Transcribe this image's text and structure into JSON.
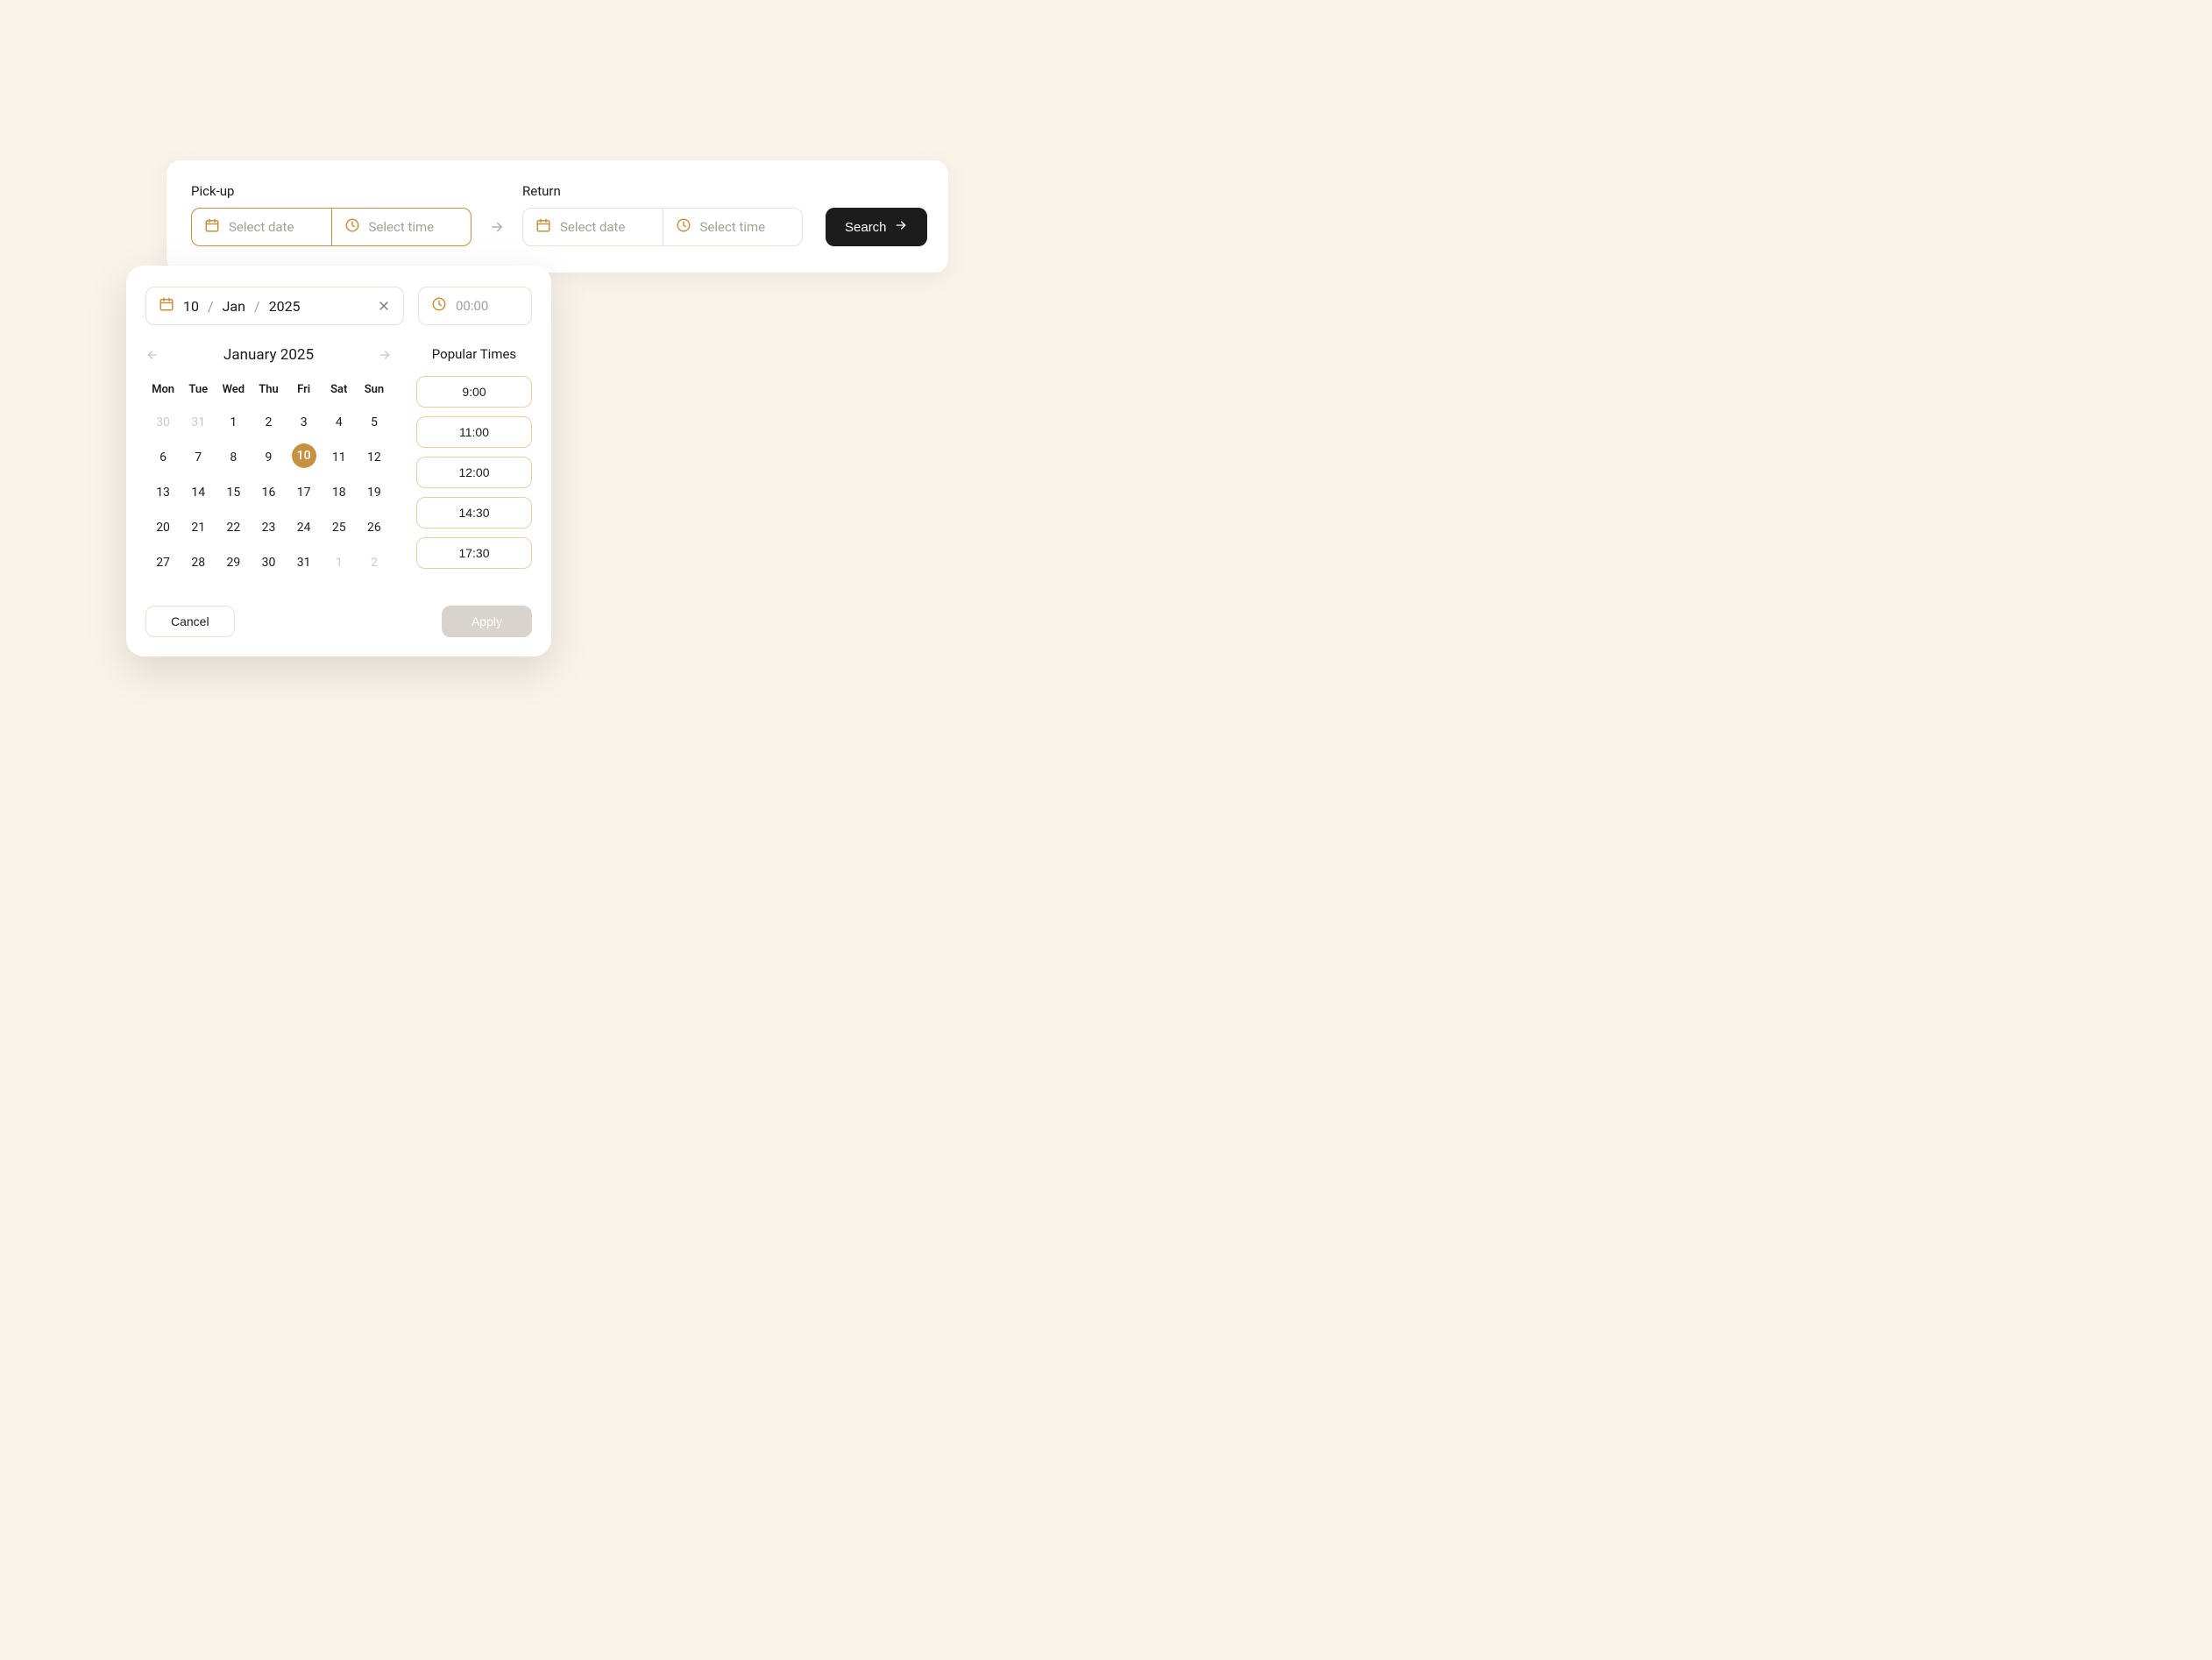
{
  "search": {
    "pickup_label": "Pick-up",
    "return_label": "Return",
    "pickup_date_placeholder": "Select date",
    "pickup_time_placeholder": "Select time",
    "return_date_placeholder": "Select date",
    "return_time_placeholder": "Select time",
    "button_label": "Search"
  },
  "popover": {
    "date_day": "10",
    "date_month": "Jan",
    "date_year": "2025",
    "time_placeholder": "00:00",
    "month_title": "January 2025",
    "dow": [
      "Mon",
      "Tue",
      "Wed",
      "Thu",
      "Fri",
      "Sat",
      "Sun"
    ],
    "weeks": [
      [
        {
          "n": "30",
          "o": true
        },
        {
          "n": "31",
          "o": true
        },
        {
          "n": "1"
        },
        {
          "n": "2"
        },
        {
          "n": "3"
        },
        {
          "n": "4"
        },
        {
          "n": "5"
        }
      ],
      [
        {
          "n": "6"
        },
        {
          "n": "7"
        },
        {
          "n": "8"
        },
        {
          "n": "9"
        },
        {
          "n": "10",
          "sel": true
        },
        {
          "n": "11"
        },
        {
          "n": "12"
        }
      ],
      [
        {
          "n": "13"
        },
        {
          "n": "14"
        },
        {
          "n": "15"
        },
        {
          "n": "16"
        },
        {
          "n": "17"
        },
        {
          "n": "18"
        },
        {
          "n": "19"
        }
      ],
      [
        {
          "n": "20"
        },
        {
          "n": "21"
        },
        {
          "n": "22"
        },
        {
          "n": "23"
        },
        {
          "n": "24"
        },
        {
          "n": "25"
        },
        {
          "n": "26"
        }
      ],
      [
        {
          "n": "27"
        },
        {
          "n": "28"
        },
        {
          "n": "29"
        },
        {
          "n": "30"
        },
        {
          "n": "31"
        },
        {
          "n": "1",
          "o": true
        },
        {
          "n": "2",
          "o": true
        }
      ]
    ],
    "popular_title": "Popular Times",
    "popular_times": [
      "9:00",
      "11:00",
      "12:00",
      "14:30",
      "17:30"
    ],
    "cancel_label": "Cancel",
    "apply_label": "Apply"
  }
}
